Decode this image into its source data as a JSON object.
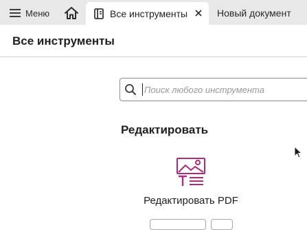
{
  "tabbar": {
    "menu_label": "Меню",
    "menu_icon": "hamburger-icon",
    "home_icon": "home-icon",
    "active_tab": {
      "label": "Все инструменты",
      "icon": "tools-doc-icon",
      "close_icon": "close-icon"
    },
    "inactive_tab": {
      "label": "Новый документ"
    }
  },
  "page": {
    "title": "Все инструменты"
  },
  "search": {
    "placeholder": "Поиск любого инструмента",
    "value": "",
    "icon": "search-icon"
  },
  "section": {
    "title": "Редактировать",
    "tools": [
      {
        "label": "Редактировать PDF",
        "icon": "edit-pdf-icon",
        "color": "#b3287d"
      }
    ]
  },
  "colors": {
    "tabbar_bg": "#e8e8e8",
    "accent": "#b3287d",
    "text": "#1f1f1f"
  }
}
